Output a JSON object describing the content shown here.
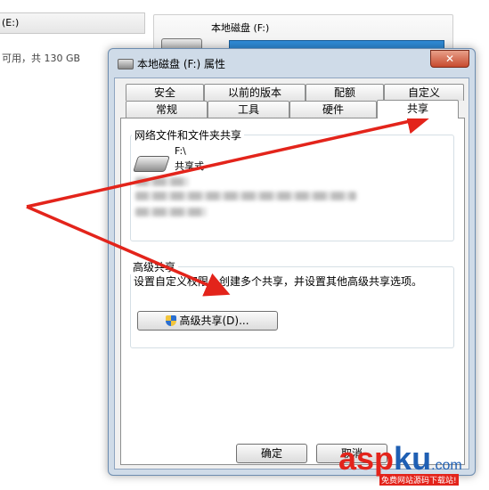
{
  "background": {
    "left_drive_label": "(E:)",
    "left_drive_free": "可用，共 130 GB",
    "right_drive_label": "本地磁盘 (F:)"
  },
  "dialog": {
    "title": "本地磁盘 (F:) 属性",
    "close_glyph": "✕",
    "tabs_row1": [
      "安全",
      "以前的版本",
      "配额",
      "自定义"
    ],
    "tabs_row2": [
      "常规",
      "工具",
      "硬件",
      "共享"
    ],
    "active_tab": "共享",
    "network_group": {
      "title": "网络文件和文件夹共享",
      "path": "F:\\",
      "status": "共享式"
    },
    "advanced_group": {
      "title": "高级共享",
      "description": "设置自定义权限，创建多个共享，并设置其他高级共享选项。",
      "button_label": "高级共享(D)..."
    },
    "ok_button": "确定",
    "cancel_button": "取消"
  },
  "watermark": {
    "brand_red": "asp",
    "brand_blue": "ku",
    "suffix": ".com",
    "tagline": "免费网站源码下载站!"
  },
  "colors": {
    "arrow": "#e3241b",
    "brand_red": "#e3241b",
    "brand_blue": "#1f5fb3"
  }
}
